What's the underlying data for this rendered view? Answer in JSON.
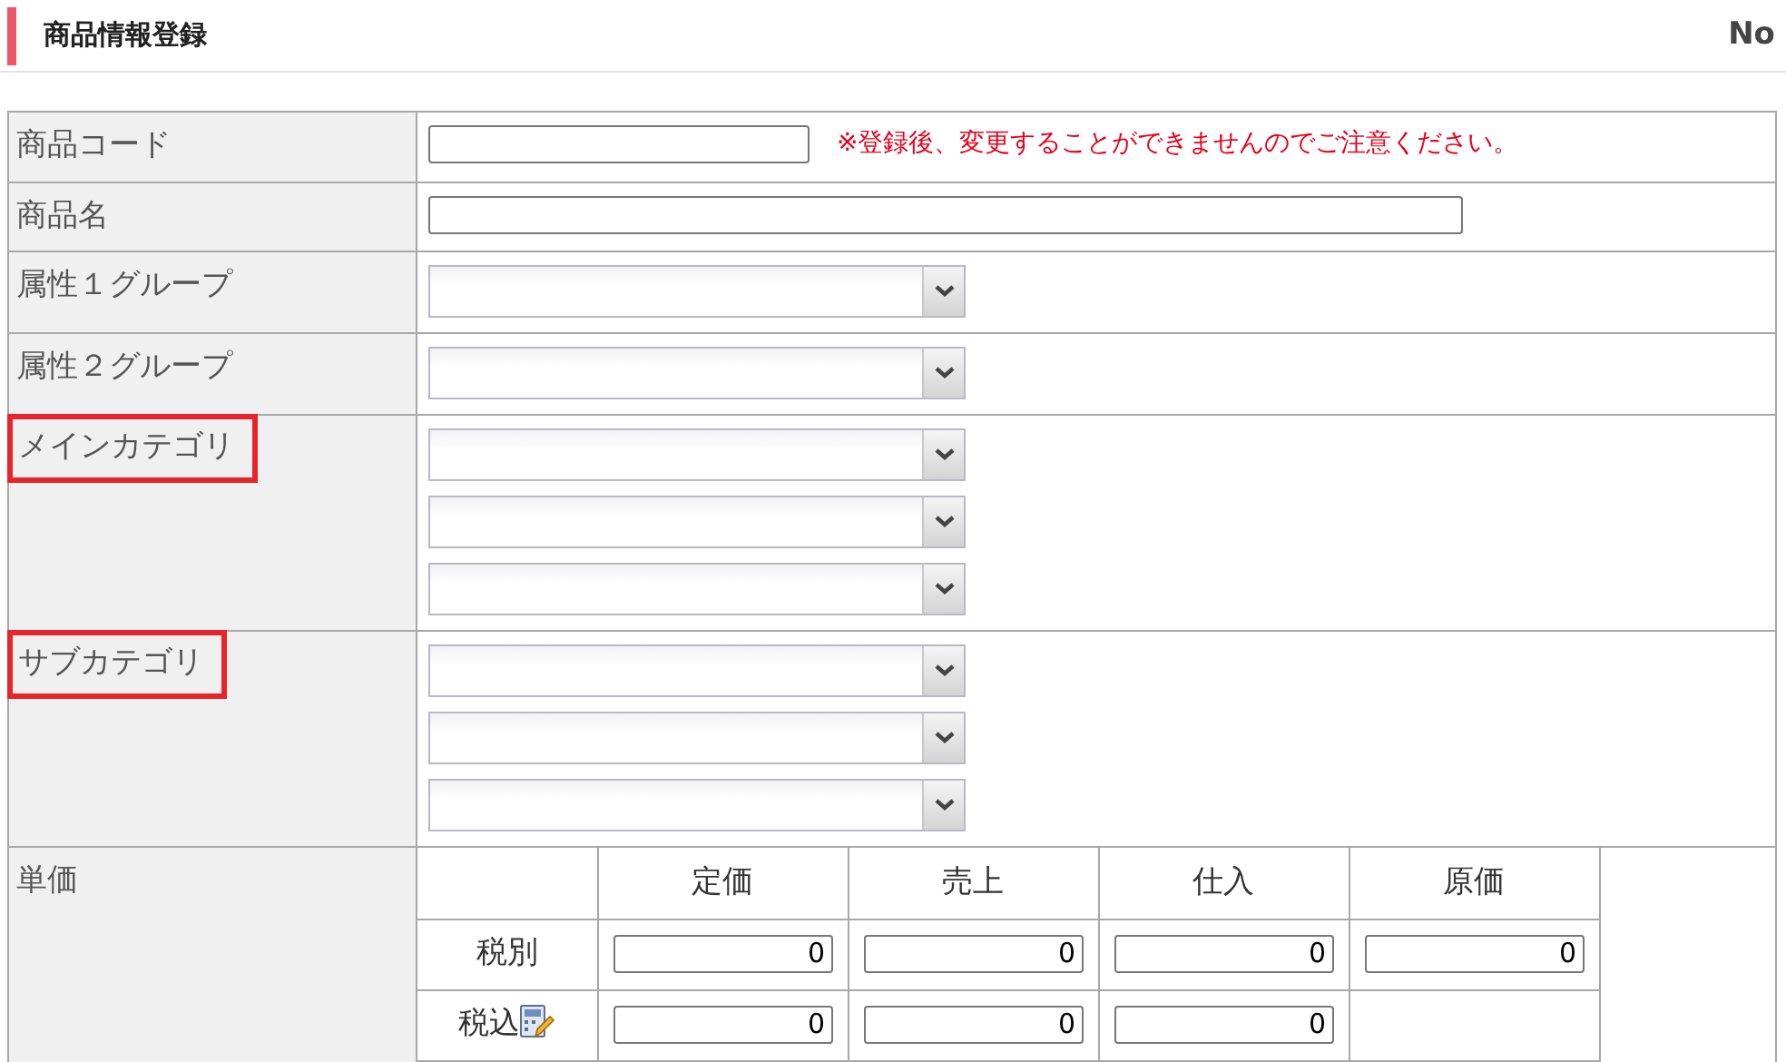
{
  "header": {
    "title": "商品情報登録",
    "right_text": "No"
  },
  "form_rows": [
    {
      "label": "商品コード",
      "highlighted": false,
      "fields": [
        {
          "kind": "short-input"
        }
      ],
      "note": "※登録後、変更することができませんのでご注意ください。"
    },
    {
      "label": "商品名",
      "highlighted": false,
      "fields": [
        {
          "kind": "long-input"
        }
      ]
    },
    {
      "label": "属性１グループ",
      "highlighted": false,
      "fields": [
        {
          "kind": "select"
        }
      ]
    },
    {
      "label": "属性２グループ",
      "highlighted": false,
      "fields": [
        {
          "kind": "select"
        }
      ]
    },
    {
      "label": "メインカテゴリ",
      "highlighted": true,
      "fields": [
        {
          "kind": "select"
        },
        {
          "kind": "select"
        },
        {
          "kind": "select"
        }
      ]
    },
    {
      "label": "サブカテゴリ",
      "highlighted": true,
      "fields": [
        {
          "kind": "select"
        },
        {
          "kind": "select"
        },
        {
          "kind": "select"
        }
      ]
    }
  ],
  "price": {
    "label": "単価",
    "columns": [
      "定価",
      "売上",
      "仕入",
      "原価"
    ],
    "rows": [
      {
        "label": "税別",
        "calculator": false,
        "values": [
          "0",
          "0",
          "0",
          "0"
        ]
      },
      {
        "label": "税込",
        "calculator": true,
        "values": [
          "0",
          "0",
          "0"
        ]
      }
    ]
  }
}
